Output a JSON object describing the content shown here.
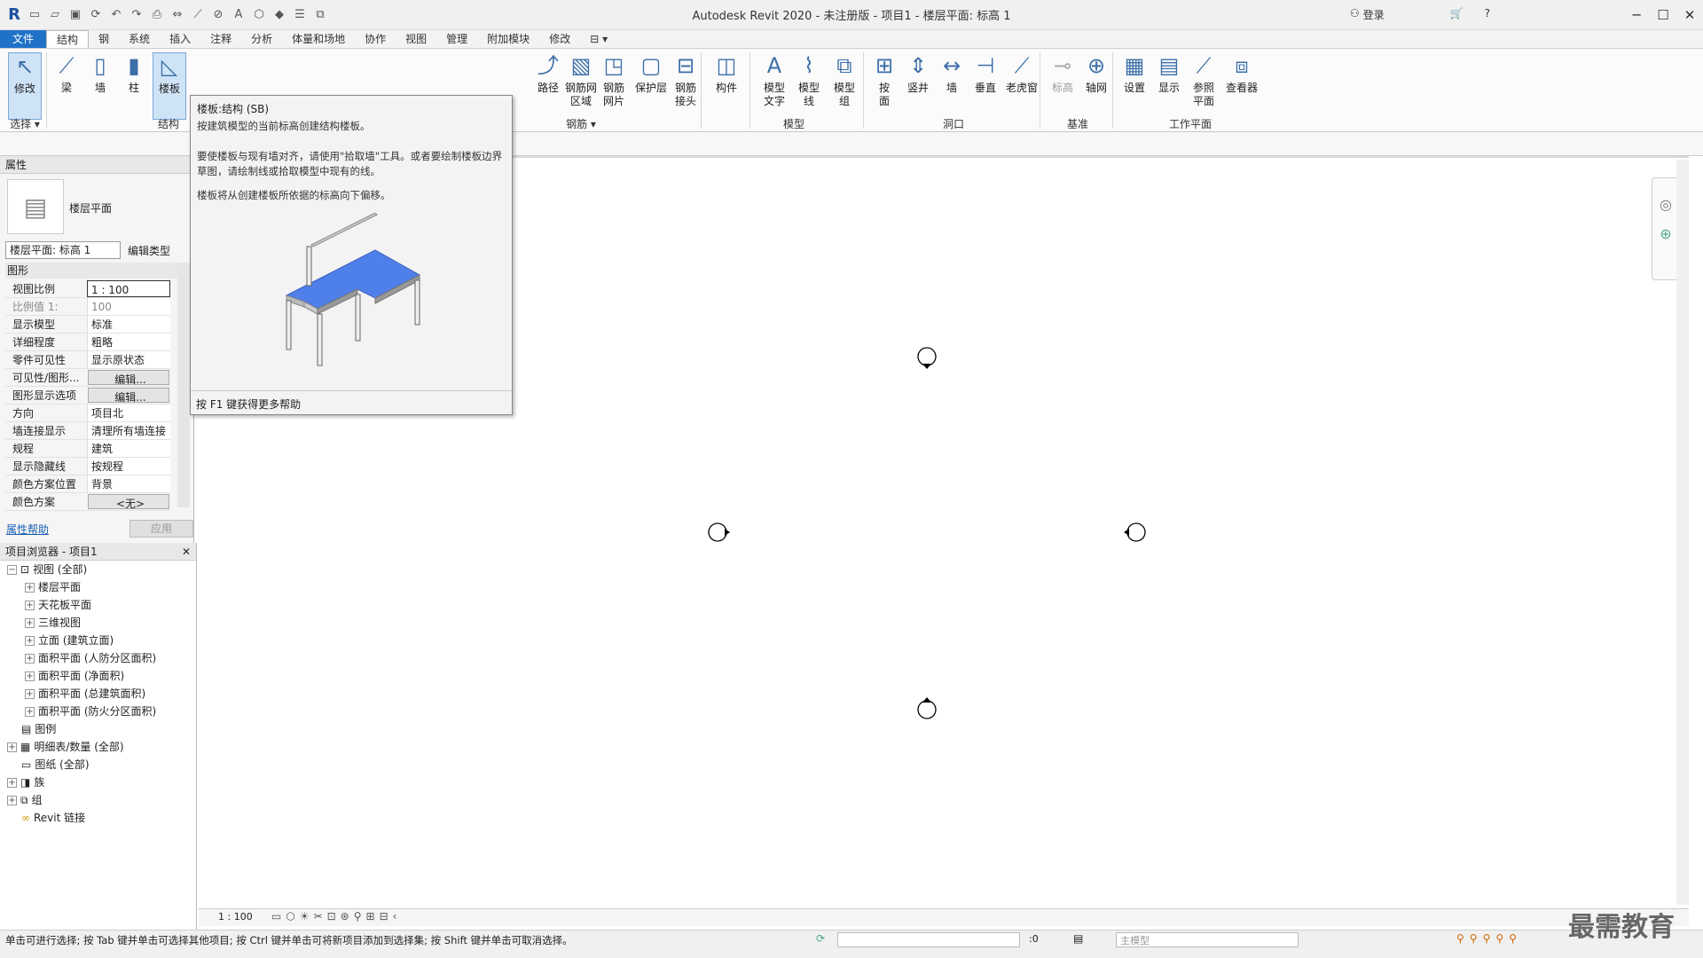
{
  "window": {
    "title": "Autodesk Revit 2020 - 未注册版 - 项目1 - 楼层平面: 标高 1",
    "login": "登录"
  },
  "tabs": [
    "文件",
    "结构",
    "钢",
    "系统",
    "插入",
    "注释",
    "分析",
    "体量和场地",
    "协作",
    "视图",
    "管理",
    "附加模块",
    "修改"
  ],
  "ribbon": {
    "buttons": [
      {
        "label": "修改"
      },
      {
        "label": "梁"
      },
      {
        "label": "墙"
      },
      {
        "label": "柱"
      },
      {
        "label": "楼板"
      },
      {
        "label": "钢筋网\n区域"
      },
      {
        "label": "钢筋\n网片"
      },
      {
        "label": "保护层"
      },
      {
        "label": "钢筋\n接头"
      },
      {
        "label": "构件"
      },
      {
        "label": "模型\n文字"
      },
      {
        "label": "模型\n线"
      },
      {
        "label": "模型\n组"
      },
      {
        "label": "按\n面"
      },
      {
        "label": "竖井"
      },
      {
        "label": "墙"
      },
      {
        "label": "垂直"
      },
      {
        "label": "老虎窗"
      },
      {
        "label": "标高"
      },
      {
        "label": "轴网"
      },
      {
        "label": "设置"
      },
      {
        "label": "显示"
      },
      {
        "label": "参照\n平面"
      },
      {
        "label": "查看器"
      },
      {
        "label": "路径"
      }
    ],
    "panels": [
      "选择 ▾",
      "结构",
      "钢筋 ▾",
      "模型",
      "洞口",
      "基准",
      "工作平面"
    ]
  },
  "tooltip": {
    "title": "楼板:结构 (SB)",
    "desc": "按建筑模型的当前标高创建结构楼板。",
    "desc2": "要使楼板与现有墙对齐，请使用\"拾取墙\"工具。或者要绘制楼板边界草图，请绘制线或拾取模型中现有的线。",
    "desc3": "楼板将从创建楼板所依据的标高向下偏移。",
    "footer": "按 F1 键获得更多帮助"
  },
  "properties": {
    "header": "属性",
    "type": "楼层平面",
    "selector": "楼层平面: 标高 1",
    "edit_type": "编辑类型",
    "group": "图形",
    "rows": [
      {
        "k": "视图比例",
        "v": "1 : 100"
      },
      {
        "k": "比例值 1:",
        "v": "100"
      },
      {
        "k": "显示模型",
        "v": "标准"
      },
      {
        "k": "详细程度",
        "v": "粗略"
      },
      {
        "k": "零件可见性",
        "v": "显示原状态"
      },
      {
        "k": "可见性/图形...",
        "v": "编辑..."
      },
      {
        "k": "图形显示选项",
        "v": "编辑..."
      },
      {
        "k": "方向",
        "v": "项目北"
      },
      {
        "k": "墙连接显示",
        "v": "清理所有墙连接"
      },
      {
        "k": "规程",
        "v": "建筑"
      },
      {
        "k": "显示隐藏线",
        "v": "按规程"
      },
      {
        "k": "颜色方案位置",
        "v": "背景"
      },
      {
        "k": "颜色方案",
        "v": "<无>"
      }
    ],
    "help": "属性帮助",
    "apply": "应用"
  },
  "browser": {
    "title": "项目浏览器 - 项目1",
    "items": [
      {
        "label": "视图 (全部)"
      },
      {
        "label": "楼层平面"
      },
      {
        "label": "天花板平面"
      },
      {
        "label": "三维视图"
      },
      {
        "label": "立面 (建筑立面)"
      },
      {
        "label": "面积平面 (人防分区面积)"
      },
      {
        "label": "面积平面 (净面积)"
      },
      {
        "label": "面积平面 (总建筑面积)"
      },
      {
        "label": "面积平面 (防火分区面积)"
      },
      {
        "label": "图例"
      },
      {
        "label": "明细表/数量 (全部)"
      },
      {
        "label": "图纸 (全部)"
      },
      {
        "label": "族"
      },
      {
        "label": "组"
      },
      {
        "label": "Revit 链接"
      }
    ]
  },
  "viewbar": {
    "scale": "1 : 100"
  },
  "status": {
    "text": "单击可进行选择; 按 Tab 键并单击可选择其他项目; 按 Ctrl 键并单击可将新项目添加到选择集; 按 Shift 键并单击可取消选择。",
    "zero": ":0",
    "model": "主模型",
    "watermark": "最需教育"
  }
}
